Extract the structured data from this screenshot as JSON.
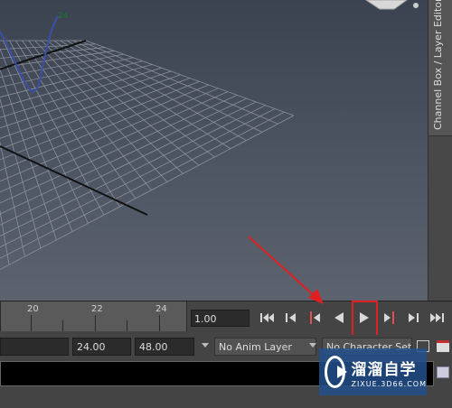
{
  "side_panel": {
    "tab_label": "Channel Box / Layer Editor"
  },
  "viewport": {
    "curve_label": "24"
  },
  "timeline": {
    "ruler_labels": [
      "20",
      "22",
      "24"
    ],
    "current_frame": "1.00"
  },
  "playback": {
    "buttons": [
      {
        "name": "go-to-start-button",
        "icon": "skip-to-start-icon"
      },
      {
        "name": "step-back-frame-button",
        "icon": "step-back-icon"
      },
      {
        "name": "step-back-key-button",
        "icon": "step-back-key-icon"
      },
      {
        "name": "play-backwards-button",
        "icon": "play-backwards-icon"
      },
      {
        "name": "play-forwards-button",
        "icon": "play-forwards-icon"
      },
      {
        "name": "step-forward-key-button",
        "icon": "step-forward-key-icon"
      },
      {
        "name": "step-forward-frame-button",
        "icon": "step-forward-icon"
      },
      {
        "name": "go-to-end-button",
        "icon": "skip-to-end-icon"
      }
    ]
  },
  "range": {
    "playback_end": "24.00",
    "animation_end": "48.00",
    "anim_layer": "No Anim Layer",
    "character_set": "No Character Set"
  },
  "watermark": {
    "title": "溜溜自学",
    "url": "ZIXUE.3D66.COM"
  },
  "colors": {
    "highlight": "#e02020",
    "arrow": "#e02020",
    "curve": "#3a50a8"
  }
}
